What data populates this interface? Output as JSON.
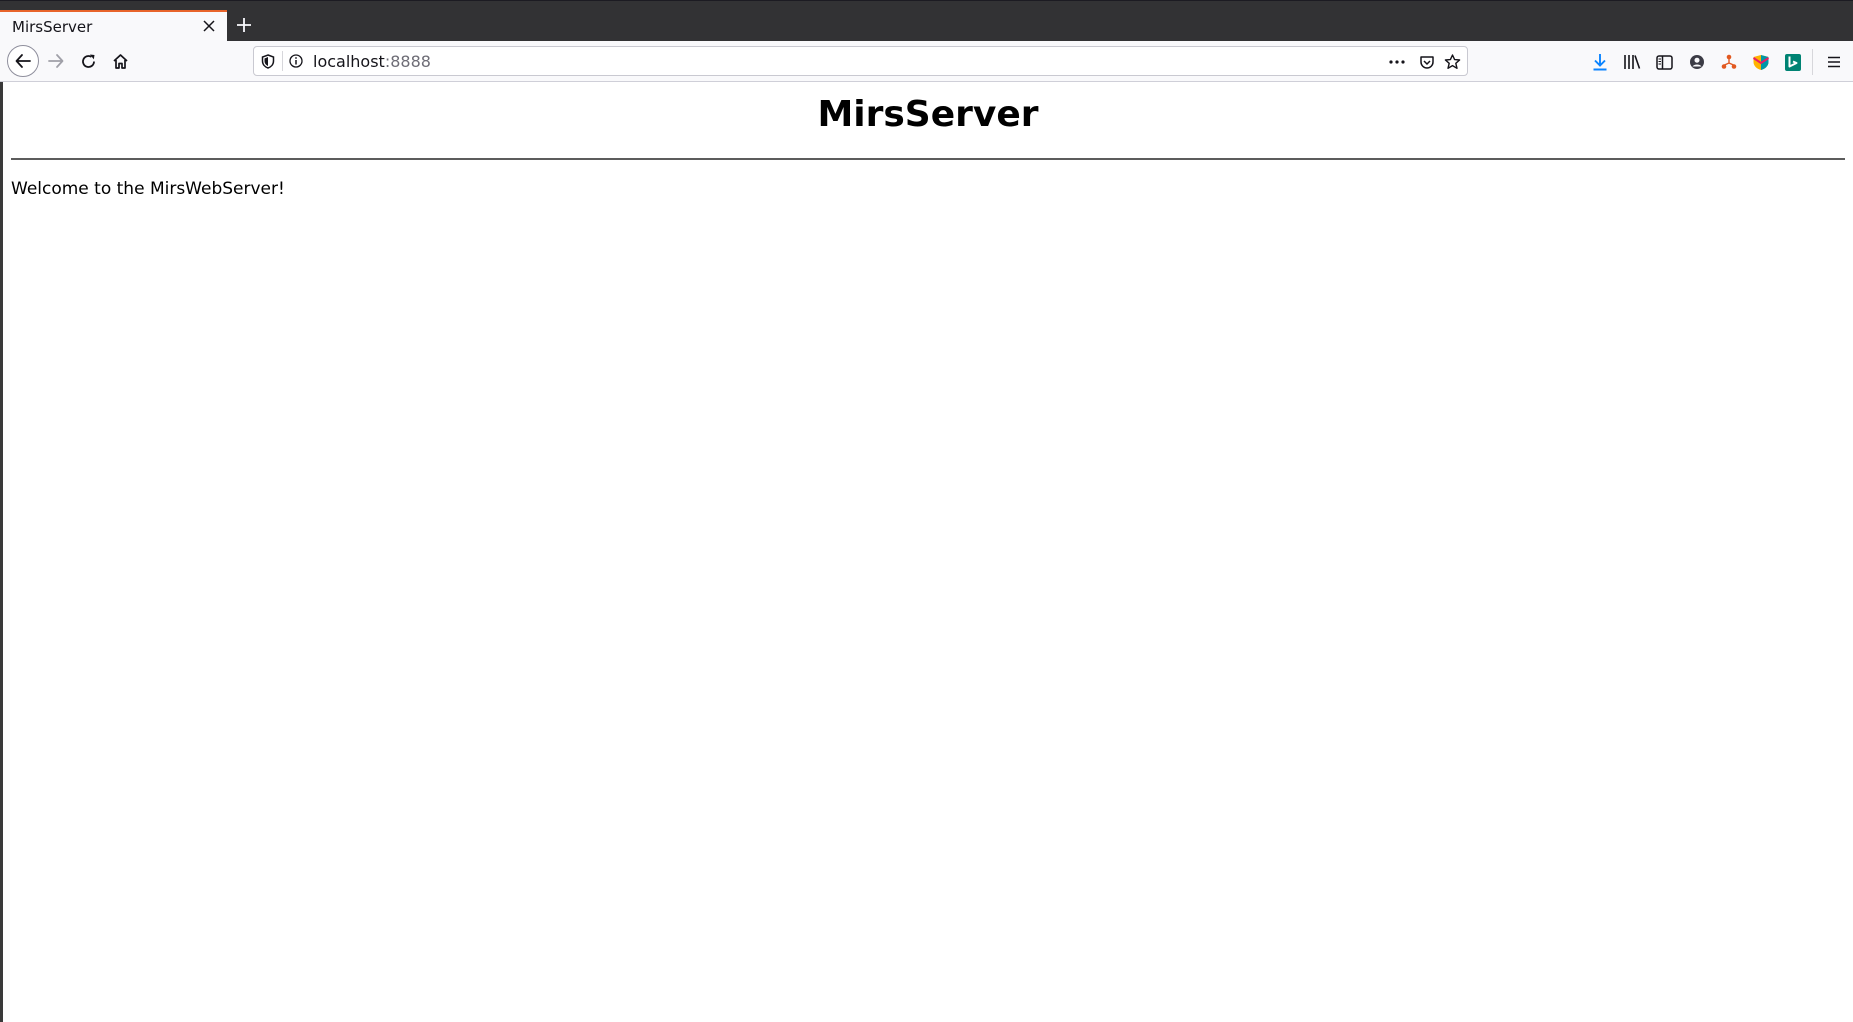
{
  "browser": {
    "tab": {
      "title": "MirsServer",
      "close_icon": "close-icon",
      "accent_color": "#e8642b"
    },
    "new_tab_icon": "plus-icon",
    "nav": {
      "back_icon": "arrow-left-icon",
      "forward_icon": "arrow-right-icon",
      "reload_icon": "reload-icon",
      "home_icon": "home-icon"
    },
    "url_bar": {
      "host": "localhost",
      "port": ":8888",
      "icons": [
        "shield-icon",
        "info-icon",
        "more-dots-icon",
        "pocket-icon",
        "star-icon"
      ]
    },
    "toolbar_icons": [
      "download-icon",
      "library-icon",
      "sidebar-icon",
      "account-icon",
      "extension-network-icon",
      "extension-shield-icon",
      "bing-icon",
      "hamburger-menu-icon"
    ],
    "colors": {
      "tabstrip": "#323234",
      "download": "#0a84ff",
      "bing": "#008373"
    }
  },
  "page": {
    "heading": "MirsServer",
    "message": "Welcome to the MirsWebServer!"
  }
}
